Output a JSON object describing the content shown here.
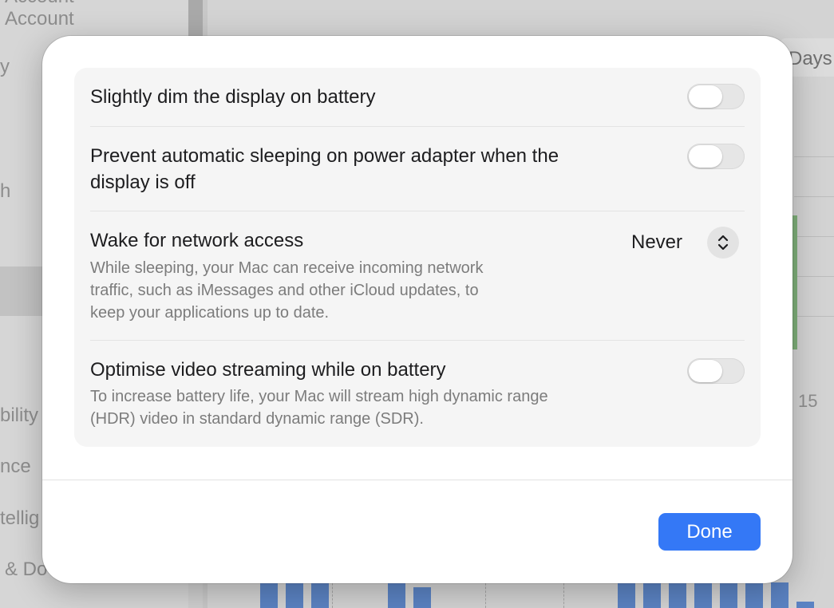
{
  "background": {
    "sidebar_fragments": [
      "Account",
      "y",
      "h",
      "bility",
      "nce",
      "tellig",
      "& Do"
    ],
    "days_tab": "Days",
    "chart_tick": "15"
  },
  "sheet": {
    "rows": [
      {
        "title": "Slightly dim the display on battery",
        "toggle_on": false
      },
      {
        "title_line1": "Prevent automatic sleeping on power adapter when the",
        "title_line2": "display is off",
        "toggle_on": false
      },
      {
        "title": "Wake for network access",
        "desc_line1": "While sleeping, your Mac can receive incoming network",
        "desc_line2": "traffic, such as iMessages and other iCloud updates, to",
        "desc_line3": "keep your applications up to date.",
        "selected_value": "Never"
      },
      {
        "title": "Optimise video streaming while on battery",
        "desc_line1": "To increase battery life, your Mac will stream high dynamic range",
        "desc_line2": "(HDR) video in standard dynamic range (SDR).",
        "toggle_on": false
      }
    ],
    "done_label": "Done"
  },
  "colors": {
    "accent": "#3478f6",
    "group_background": "#f5f5f5",
    "secondary_text": "#7c7c7c"
  },
  "icons": {
    "popup_indicator": "chevron-up-down-icon"
  }
}
